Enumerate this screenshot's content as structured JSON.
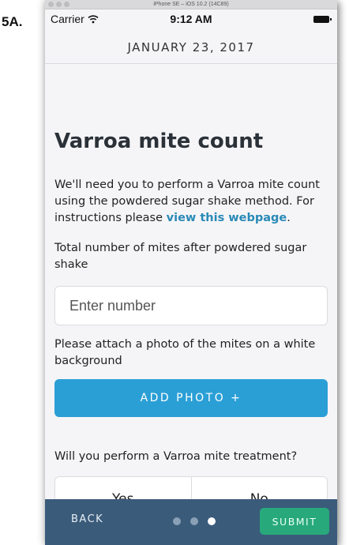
{
  "figure_label": "5A.",
  "simulator": {
    "title": "iPhone SE – iOS 10.2 (14C89)"
  },
  "status_bar": {
    "carrier": "Carrier",
    "time": "9:12 AM"
  },
  "header": {
    "date": "JANUARY 23, 2017"
  },
  "main": {
    "title": "Varroa mite count",
    "intro_text": "We'll need you to perform a Varroa mite count using the powdered sugar shake method. For instructions please ",
    "intro_link": "view this webpage",
    "intro_end": ".",
    "mite_count_label": "Total number of mites after powdered sugar shake",
    "mite_count_placeholder": "Enter number",
    "photo_label": "Please attach a photo of the mites on a white background",
    "add_photo_label": "ADD PHOTO +",
    "treatment_question": "Will you perform a Varroa mite treatment?",
    "treatment_options": [
      "Yes",
      "No"
    ]
  },
  "footer": {
    "back_label": "BACK",
    "submit_label": "SUBMIT",
    "pages": 3,
    "current_page": 3
  },
  "colors": {
    "accent": "#2a9fd6",
    "link": "#2a8ab7",
    "bottom_bar": "#3b5b7a",
    "submit": "#28a97c"
  }
}
